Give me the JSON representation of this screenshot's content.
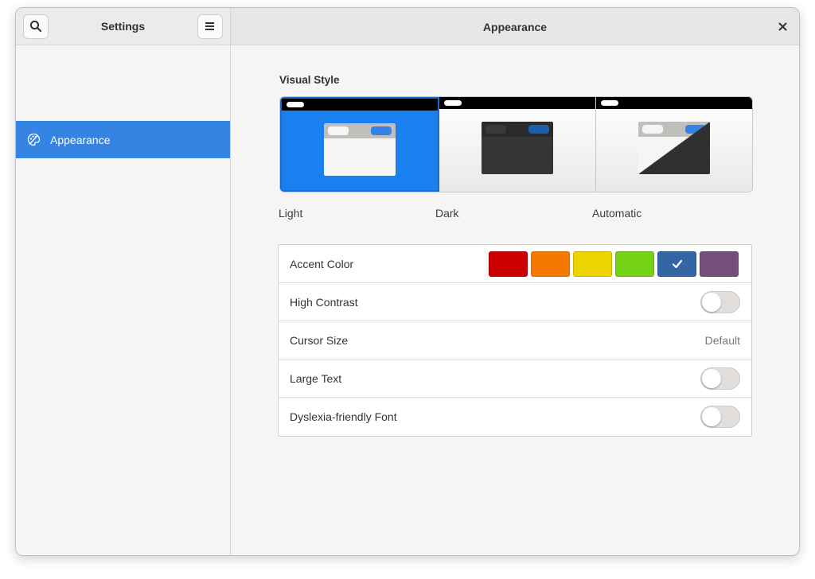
{
  "sidebar_header": {
    "title": "Settings"
  },
  "main_header": {
    "title": "Appearance"
  },
  "sidebar": {
    "items": [
      {
        "label": "Appearance",
        "icon": "palette-icon",
        "selected": true
      }
    ]
  },
  "visual_style": {
    "title": "Visual Style",
    "options": [
      {
        "label": "Light",
        "selected": true
      },
      {
        "label": "Dark",
        "selected": false
      },
      {
        "label": "Automatic",
        "selected": false
      }
    ]
  },
  "settings": {
    "accent_color": {
      "label": "Accent Color",
      "colors": [
        "#cc0000",
        "#f57900",
        "#edd400",
        "#73d216",
        "#3465a4",
        "#75507b"
      ],
      "selected_index": 4
    },
    "high_contrast": {
      "label": "High Contrast",
      "enabled": false
    },
    "cursor_size": {
      "label": "Cursor Size",
      "value": "Default"
    },
    "large_text": {
      "label": "Large Text",
      "enabled": false
    },
    "dyslexia_font": {
      "label": "Dyslexia-friendly Font",
      "enabled": false
    }
  },
  "colors": {
    "accent": "#3584e4",
    "window_bg": "#f6f5f4"
  }
}
